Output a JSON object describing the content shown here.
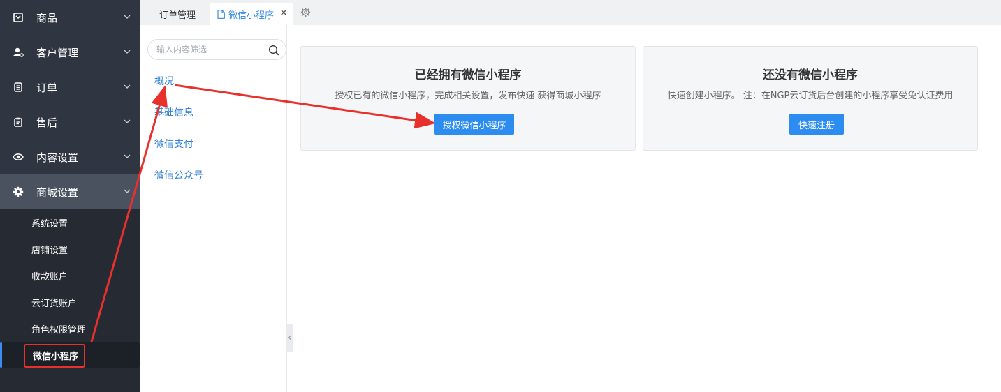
{
  "sidebar": {
    "menu": [
      {
        "label": "商品",
        "icon": "box-icon"
      },
      {
        "label": "客户管理",
        "icon": "user-icon"
      },
      {
        "label": "订单",
        "icon": "list-icon"
      },
      {
        "label": "售后",
        "icon": "clipboard-icon"
      },
      {
        "label": "内容设置",
        "icon": "eye-icon"
      },
      {
        "label": "商城设置",
        "icon": "gear-icon"
      }
    ],
    "submenu": [
      {
        "label": "系统设置"
      },
      {
        "label": "店铺设置"
      },
      {
        "label": "收款账户"
      },
      {
        "label": "云订货账户"
      },
      {
        "label": "角色权限管理"
      },
      {
        "label": "微信小程序"
      }
    ]
  },
  "tabs": {
    "first": "订单管理",
    "current": "微信小程序",
    "close": "✕"
  },
  "subnav": {
    "search_placeholder": "输入内容筛选",
    "links": [
      {
        "label": "概况"
      },
      {
        "label": "基础信息"
      },
      {
        "label": "微信支付"
      },
      {
        "label": "微信公众号"
      }
    ]
  },
  "cards": [
    {
      "title": "已经拥有微信小程序",
      "desc": "授权已有的微信小程序，完成相关设置，发布快速 获得商城小程序",
      "button": "授权微信小程序"
    },
    {
      "title": "还没有微信小程序",
      "desc": "快速创建小程序。 注：在NGP云订货后台创建的小程序享受免认证费用",
      "button": "快速注册"
    }
  ],
  "colors": {
    "sidebar_bg": "#303641",
    "primary": "#2d8cf0",
    "annotation": "#e8302c"
  }
}
